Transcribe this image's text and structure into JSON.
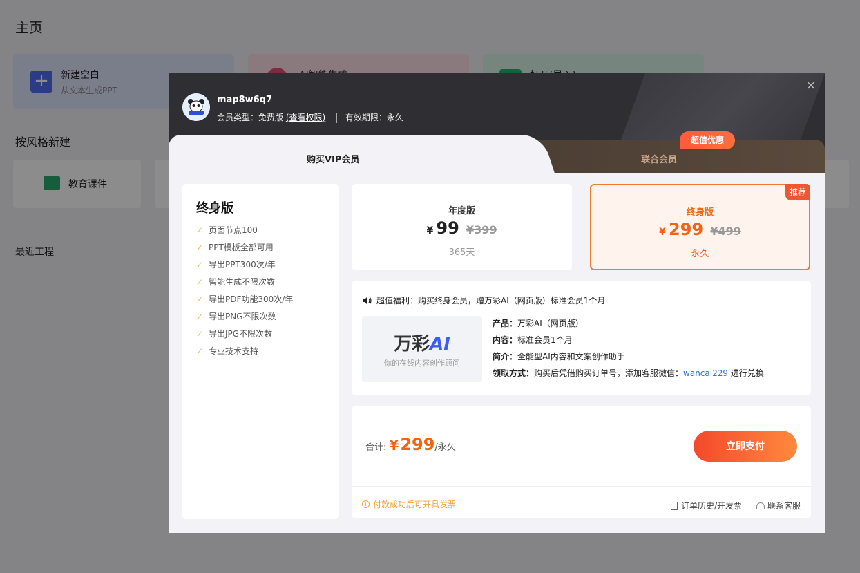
{
  "background": {
    "page_title": "主页",
    "cards": [
      {
        "title": "新建空白",
        "subtitle": "从文本生成PPT"
      },
      {
        "title": "AI智能生成"
      },
      {
        "title": "打开(导入)"
      }
    ],
    "style_section_title": "按风格新建",
    "style_items": [
      "教育课件"
    ],
    "recent_title": "最近工程"
  },
  "modal": {
    "username": "map8w6q7",
    "member_type_label": "会员类型：",
    "member_type_value": "免费版",
    "view_rights": "(查看权限)",
    "validity_label": "有效期限：",
    "validity_value": "永久",
    "tabs": {
      "vip": "购买VIP会员",
      "joint": "联合会员",
      "joint_badge": "超值优惠"
    },
    "features": {
      "title": "终身版",
      "items": [
        "页面节点100",
        "PPT模板全部可用",
        "导出PPT300次/年",
        "智能生成不限次数",
        "导出PDF功能300次/年",
        "导出PNG不限次数",
        "导出JPG不限次数",
        "专业技术支持"
      ]
    },
    "plans": [
      {
        "name": "年度版",
        "currency": "¥",
        "price": "99",
        "old_price": "¥399",
        "duration": "365天"
      },
      {
        "name": "终身版",
        "currency": "¥",
        "price": "299",
        "old_price": "¥499",
        "duration": "永久",
        "badge": "推荐"
      }
    ],
    "bonus": {
      "headline": "超值福利：购买终身会员，赠万彩AI（网页版）标准会员1个月",
      "brand_name": "万彩",
      "brand_ai": "AI",
      "brand_tagline": "你的在线内容创作顾问",
      "product_label": "产品：",
      "product_value": "万彩AI（网页版）",
      "content_label": "内容：",
      "content_value": "标准会员1个月",
      "intro_label": "简介：",
      "intro_value": "全能型AI内容和文案创作助手",
      "claim_label": "领取方式：",
      "claim_value": "购买后凭借购买订单号，添加客服微信：",
      "wechat": "wancai229",
      "claim_suffix": " 进行兑换"
    },
    "pay": {
      "total_label": "合计:",
      "currency": "¥",
      "amount": "299",
      "unit": "/永久",
      "pay_button": "立即支付",
      "invoice_note": "付款成功后可开具发票",
      "order_history": "订单历史/开发票",
      "support": "联系客服"
    }
  }
}
